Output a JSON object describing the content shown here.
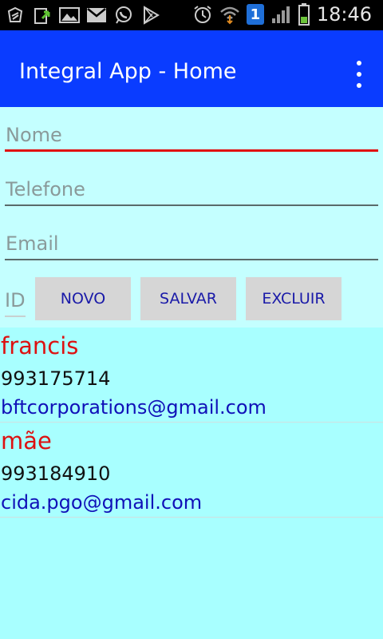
{
  "status_bar": {
    "time": "18:46",
    "sim_badge": "1",
    "icons": [
      "usb-debug-icon",
      "download-icon",
      "gallery-icon",
      "gmail-icon",
      "whatsapp-icon",
      "play-store-icon",
      "alarm-icon",
      "wifi-icon",
      "signal-icon",
      "battery-icon"
    ]
  },
  "app_bar": {
    "title": "Integral App - Home",
    "menu_icon": "overflow-menu-icon"
  },
  "form": {
    "name_placeholder": "Nome",
    "phone_placeholder": "Telefone",
    "email_placeholder": "Email",
    "id_placeholder": "ID",
    "buttons": {
      "new_label": "NOVO",
      "save_label": "SALVAR",
      "delete_label": "EXCLUIR"
    }
  },
  "contacts": [
    {
      "name": "francis",
      "phone": "993175714",
      "email": "bftcorporations@gmail.com"
    },
    {
      "name": "mãe",
      "phone": "993184910",
      "email": "cida.pgo@gmail.com"
    }
  ],
  "colors": {
    "status_bar": "#000000",
    "app_bar": "#0a3cff",
    "form_background": "#c4ffff",
    "list_background": "#a8ffff",
    "focus_underline": "#e01010",
    "contact_name": "#dd1111",
    "contact_email": "#1010b8",
    "button_background": "#d6d6d6",
    "button_text": "#1a1aa8"
  }
}
